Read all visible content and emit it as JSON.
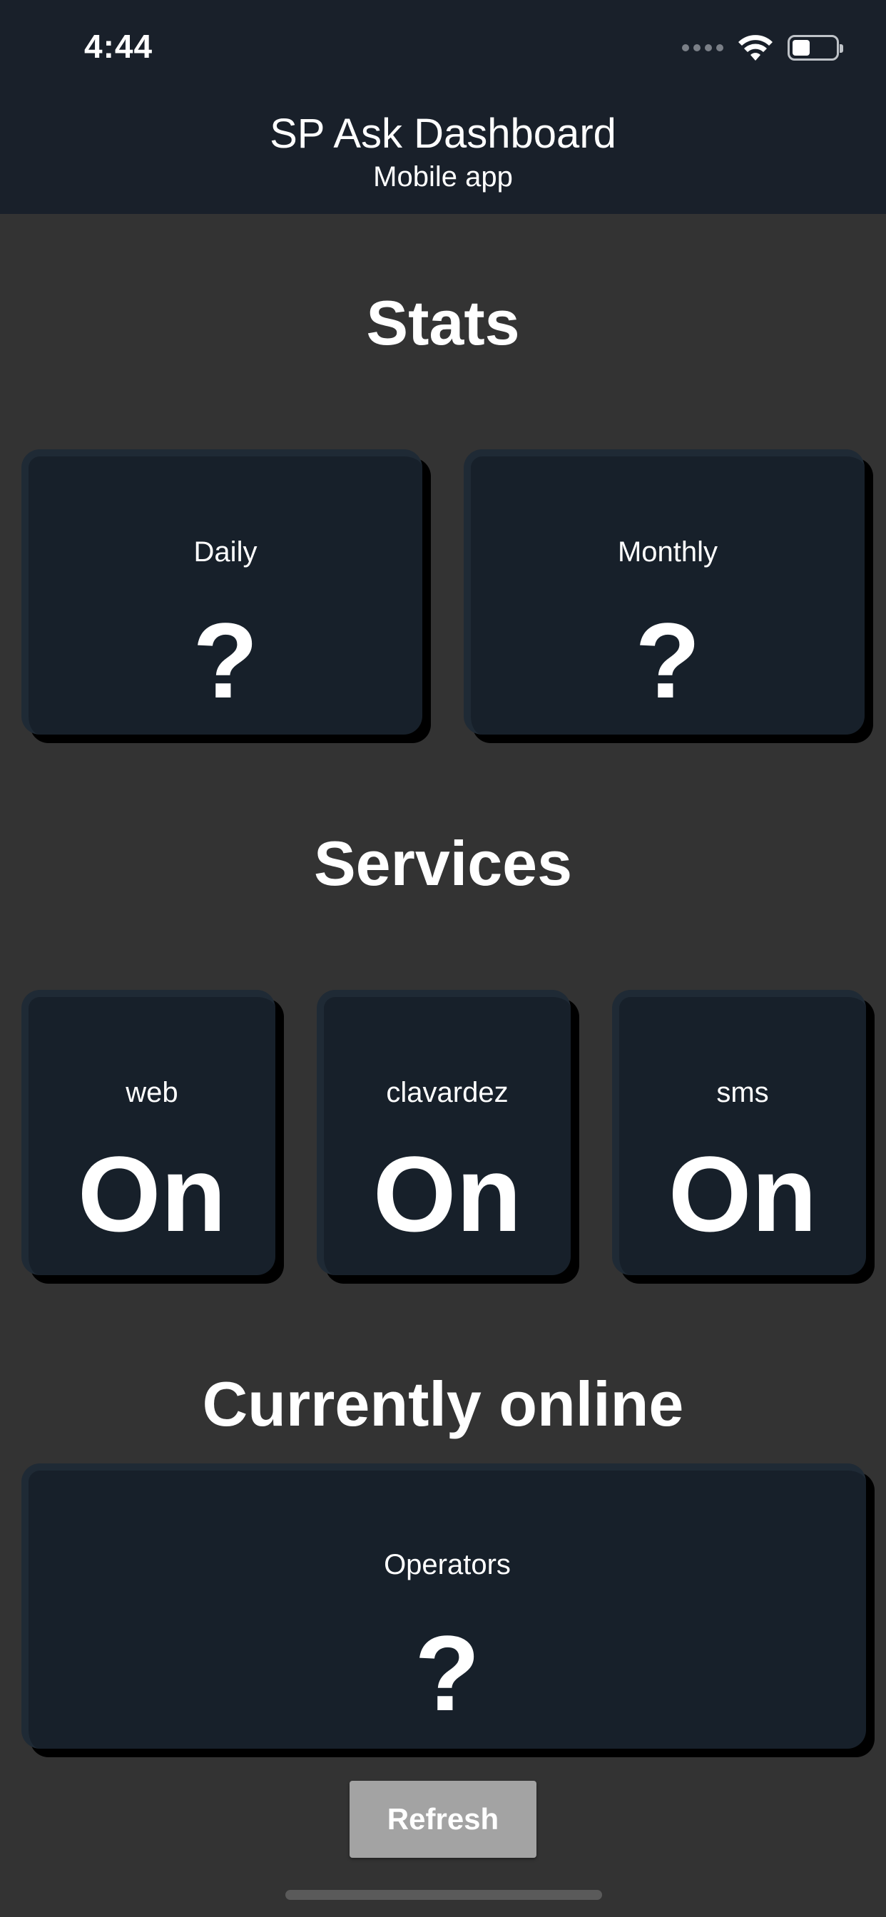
{
  "status_bar": {
    "time": "4:44",
    "icons": [
      "signal-icon",
      "wifi-icon",
      "battery-icon"
    ]
  },
  "header": {
    "title": "SP Ask Dashboard",
    "subtitle": "Mobile app",
    "background": "#19202a"
  },
  "stats": {
    "heading": "Stats",
    "daily": {
      "label": "Daily",
      "value": "?"
    },
    "monthly": {
      "label": "Monthly",
      "value": "?"
    }
  },
  "services": {
    "heading": "Services",
    "items": [
      {
        "label": "web",
        "value": "On"
      },
      {
        "label": "clavardez",
        "value": "On"
      },
      {
        "label": "sms",
        "value": "On"
      }
    ]
  },
  "online": {
    "heading": "Currently online",
    "operators": {
      "label": "Operators",
      "value": "?"
    }
  },
  "actions": {
    "refresh_label": "Refresh"
  },
  "colors": {
    "page_background": "#333333",
    "card_background": "#17202a",
    "button_background": "#a3a3a3"
  }
}
